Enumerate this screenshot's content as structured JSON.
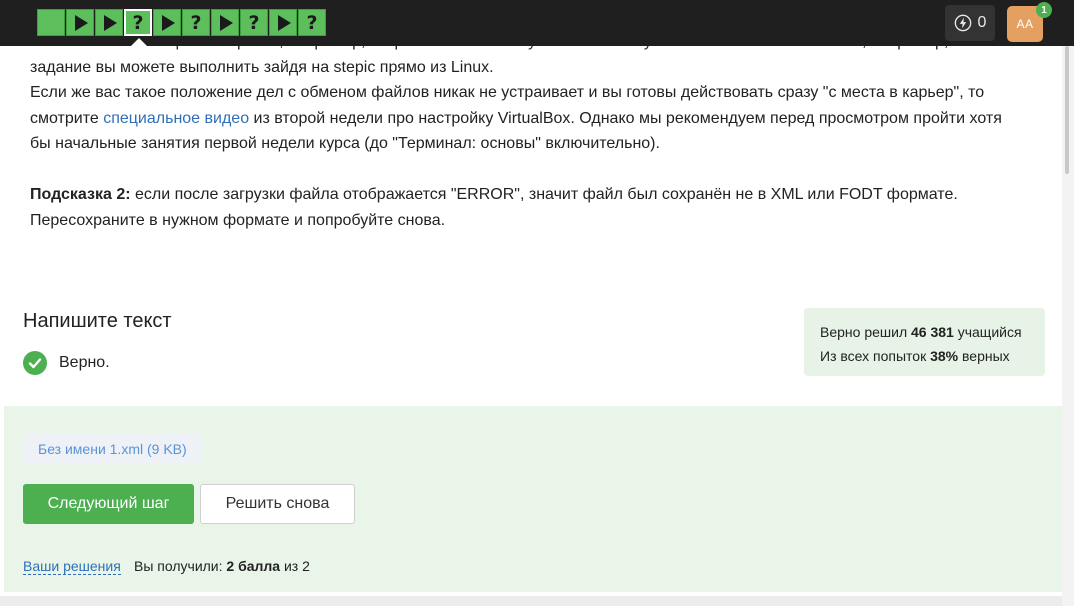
{
  "steps": [
    {
      "kind": "done-square"
    },
    {
      "kind": "play"
    },
    {
      "kind": "play"
    },
    {
      "kind": "question",
      "label": "?",
      "current": true
    },
    {
      "kind": "play"
    },
    {
      "kind": "question",
      "label": "?"
    },
    {
      "kind": "play"
    },
    {
      "kind": "question",
      "label": "?"
    },
    {
      "kind": "play"
    },
    {
      "kind": "question",
      "label": "?"
    }
  ],
  "header": {
    "energy_count": "0",
    "avatar_initials": "АА",
    "notification_count": "1"
  },
  "article": {
    "line1": "системами с помощью интернета, например, отправляя их на почту из Linux и получая в основной системе или, например, это",
    "line2": "задание вы можете выполнить зайдя на stepic прямо из Linux.",
    "line3": "Если же вас такое положение дел с обменом файлов никак не устраивает и вы готовы действовать сразу \"с места в карьер\", то",
    "line4_pre": "смотрите ",
    "line4_link": "специальное видео",
    "line4_post": " из второй недели про настройку VirtualBox. Однако мы рекомендуем перед просмотром пройти хотя",
    "line5": "бы начальные занятия первой недели курса (до \"Терминал: основы\" включительно).",
    "hint_label": "Подсказка 2:",
    "hint_text": " если после загрузки файла отображается \"ERROR\", значит файл был сохранён не в XML или FODT формате.",
    "hint_line2": "Пересохраните в нужном формате и попробуйте снова."
  },
  "task": {
    "title": "Напишите текст",
    "verdict": "Верно."
  },
  "stats": {
    "solved_prefix": "Верно решил ",
    "solved_count": "46 381",
    "solved_suffix": " учащийся",
    "attempts_prefix": "Из всех попыток ",
    "attempts_percent": "38%",
    "attempts_suffix": " верных"
  },
  "submission": {
    "file_name": "Без имени 1.xml (9 KB)",
    "next_button": "Следующий шаг",
    "retry_button": "Решить снова",
    "solutions_link": "Ваши решения",
    "score_prefix": "Вы получили: ",
    "score_value": "2 балла",
    "score_suffix": " из 2"
  },
  "colors": {
    "success": "#4caf50",
    "link": "#2f6fb9",
    "topbar": "#1f1f1f"
  }
}
